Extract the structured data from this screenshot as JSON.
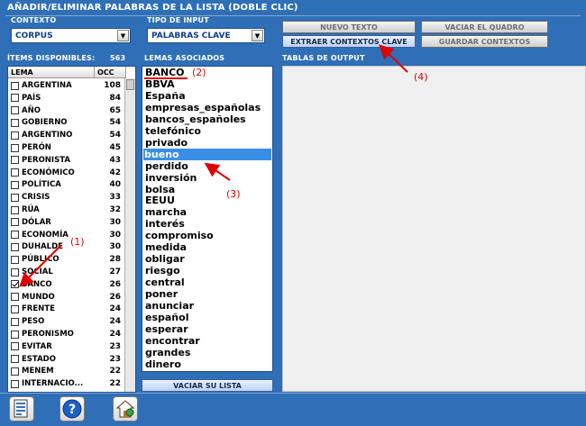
{
  "window": {
    "title": "AÑADIR/ELIMINAR PALABRAS DE LA LISTA (DOBLE CLIC)"
  },
  "contexto": {
    "label": "CONTEXTO",
    "value": "CORPUS"
  },
  "tipo_input": {
    "label": "TIPO DE INPUT",
    "value": "PALABRAS CLAVE"
  },
  "buttons": {
    "nuevo_texto": "NUEVO TEXTO",
    "vaciar_cuadro": "VACIAR EL QUADRO",
    "extraer": "EXTRAER CONTEXTOS CLAVE",
    "guardar": "GUARDAR CONTEXTOS",
    "vaciar_lista": "VACIAR SU LISTA"
  },
  "items": {
    "header": "ÍTEMS DISPONIBLES:",
    "count": "563",
    "col_lema": "LEMA",
    "col_occ": "OCC",
    "rows": [
      {
        "lema": "ARGENTINA",
        "occ": "108",
        "checked": false
      },
      {
        "lema": "PAÍS",
        "occ": "84",
        "checked": false
      },
      {
        "lema": "AÑO",
        "occ": "65",
        "checked": false
      },
      {
        "lema": "GOBIERNO",
        "occ": "54",
        "checked": false
      },
      {
        "lema": "ARGENTINO",
        "occ": "54",
        "checked": false
      },
      {
        "lema": "PERÓN",
        "occ": "45",
        "checked": false
      },
      {
        "lema": "PERONISTA",
        "occ": "43",
        "checked": false
      },
      {
        "lema": "ECONÓMICO",
        "occ": "42",
        "checked": false
      },
      {
        "lema": "POLÍTICA",
        "occ": "40",
        "checked": false
      },
      {
        "lema": "CRISIS",
        "occ": "33",
        "checked": false
      },
      {
        "lema": "RÚA",
        "occ": "32",
        "checked": false
      },
      {
        "lema": "DÓLAR",
        "occ": "30",
        "checked": false
      },
      {
        "lema": "ECONOMÍA",
        "occ": "30",
        "checked": false
      },
      {
        "lema": "DUHALDE",
        "occ": "30",
        "checked": false
      },
      {
        "lema": "PÚBLICO",
        "occ": "28",
        "checked": false
      },
      {
        "lema": "SOCIAL",
        "occ": "27",
        "checked": false
      },
      {
        "lema": "BANCO",
        "occ": "26",
        "checked": true
      },
      {
        "lema": "MUNDO",
        "occ": "26",
        "checked": false
      },
      {
        "lema": "FRENTE",
        "occ": "24",
        "checked": false
      },
      {
        "lema": "PESO",
        "occ": "24",
        "checked": false
      },
      {
        "lema": "PERONISMO",
        "occ": "24",
        "checked": false
      },
      {
        "lema": "EVITAR",
        "occ": "23",
        "checked": false
      },
      {
        "lema": "ESTADO",
        "occ": "23",
        "checked": false
      },
      {
        "lema": "MENEM",
        "occ": "22",
        "checked": false
      },
      {
        "lema": "INTERNACIO...",
        "occ": "22",
        "checked": false
      }
    ]
  },
  "lemas": {
    "header": "LEMAS ASOCIADOS",
    "list": [
      "BANCO",
      "BBVA",
      "España",
      "empresas_españolas",
      "bancos_españoles",
      "telefónico",
      "privado",
      "bueno",
      "perdido",
      "inversión",
      "bolsa",
      "EEUU",
      "marcha",
      "interés",
      "compromiso",
      "medida",
      "obligar",
      "riesgo",
      "central",
      "poner",
      "anunciar",
      "español",
      "esperar",
      "encontrar",
      "grandes",
      "dinero"
    ]
  },
  "output": {
    "header": "TABLAS DE OUTPUT"
  },
  "annotations": [
    "(1)",
    "(2)",
    "(3)",
    "(4)"
  ],
  "colors": {
    "background": "#2f6fb7",
    "selection": "#3a8ee6",
    "annotation": "#e00000"
  },
  "icons": [
    "document-icon",
    "help-icon",
    "home-icon"
  ]
}
